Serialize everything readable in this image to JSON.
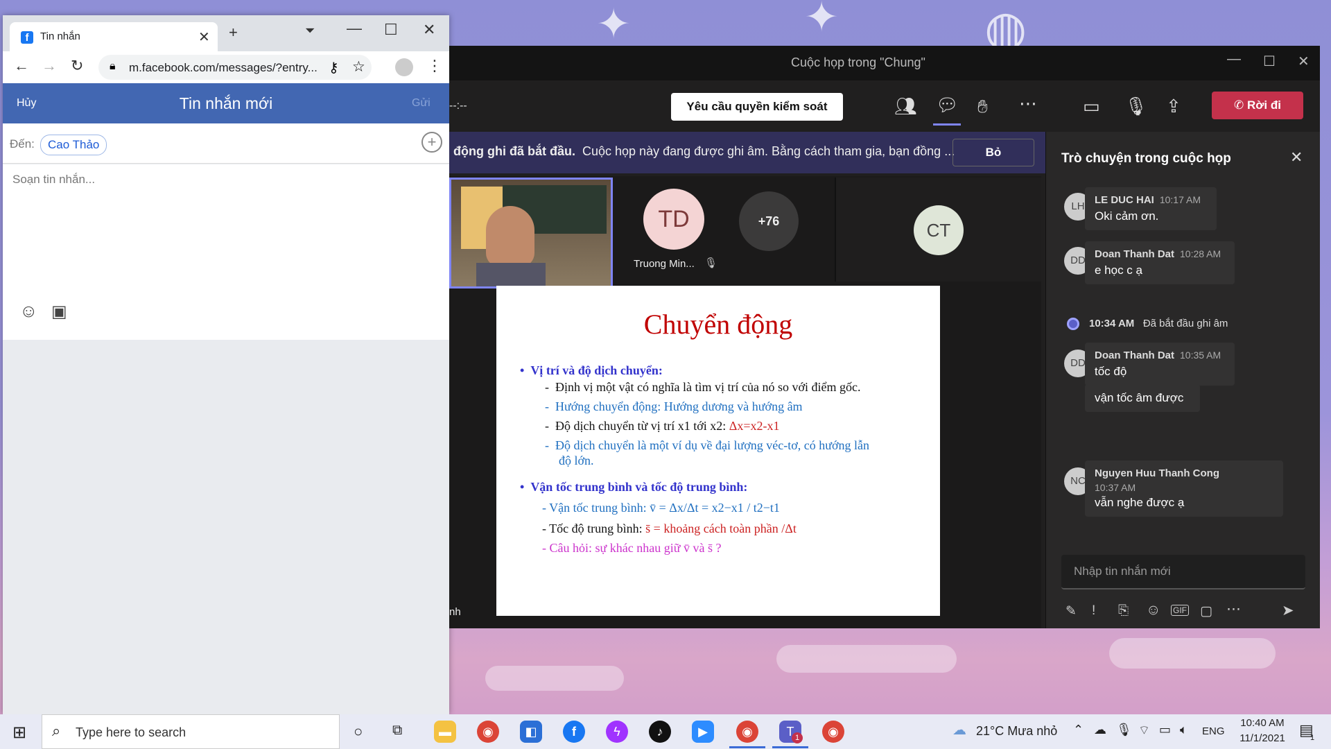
{
  "browser": {
    "tab_title": "Tin nhắn",
    "url": "m.facebook.com/messages/?entry...",
    "fb": {
      "cancel": "Hủy",
      "title": "Tin nhắn mới",
      "send": "Gửi",
      "to_label": "Đến:",
      "recipient": "Cao Thảo",
      "compose_placeholder": "Soạn tin nhắn..."
    }
  },
  "teams": {
    "window_title": "Cuộc họp trong \"Chung\"",
    "timer": "--:--",
    "request_control": "Yêu cầu quyền kiểm soát",
    "leave": "Rời đi",
    "banner_bold": "động ghi đã bắt đầu.",
    "banner_text": "Cuộc họp này đang được ghi âm. Bằng cách tham gia, bạn đồng ...",
    "banner_dismiss": "Bỏ",
    "participants": {
      "td_initials": "TD",
      "td_name": "Truong Min...",
      "more": "+76",
      "ct_initials": "CT"
    },
    "stage_label": "nh",
    "slide": {
      "title": "Chuyển động",
      "b1": "Vị trí và độ dịch chuyển:",
      "l1": "Định vị một vật có nghĩa là tìm vị trí của nó so với điểm gốc.",
      "l2": "Hướng chuyển động: Hướng dương và hướng âm",
      "l3a": "Độ dịch chuyển từ vị trí x1 tới x2: ",
      "l3b": "Δx=x2-x1",
      "l4a": "Độ dịch chuyển là một ví dụ về đại lượng véc-tơ, có hướng lẫn",
      "l4b": "độ lớn.",
      "b2": "Vận tốc trung bình và tốc độ trung bình:",
      "l5": "- Vận tốc trung bình: v̄ = Δx/Δt = x2−x1 / t2−t1",
      "l6a": "- Tốc độ trung bình: ",
      "l6b": "s̄ = khoảng cách toàn phần /Δt",
      "l7": "- Câu hỏi: sự khác nhau giữ v̄ và s̄ ?"
    },
    "chat": {
      "title": "Trò chuyện trong cuộc họp",
      "messages": [
        {
          "initials": "LH",
          "name": "LE DUC HAI",
          "time": "10:17 AM",
          "text": "Oki cảm ơn."
        },
        {
          "initials": "DD",
          "name": "Doan Thanh Dat",
          "time": "10:28 AM",
          "text": "e học c ạ"
        },
        {
          "initials": "DD",
          "name": "Doan Thanh Dat",
          "time": "10:35 AM",
          "text": "tốc độ",
          "text2": "vận tốc âm được"
        },
        {
          "initials": "NC",
          "name": "Nguyen Huu Thanh Cong",
          "time": "10:37 AM",
          "text": "vẫn nghe được ạ"
        }
      ],
      "system_time": "10:34 AM",
      "system_text": "Đã bắt đầu ghi âm",
      "input_placeholder": "Nhập tin nhắn mới"
    }
  },
  "taskbar": {
    "search_placeholder": "Type here to search",
    "weather": "21°C  Mưa nhỏ",
    "lang": "ENG",
    "time": "10:40 AM",
    "date": "11/1/2021",
    "notif": "1"
  }
}
